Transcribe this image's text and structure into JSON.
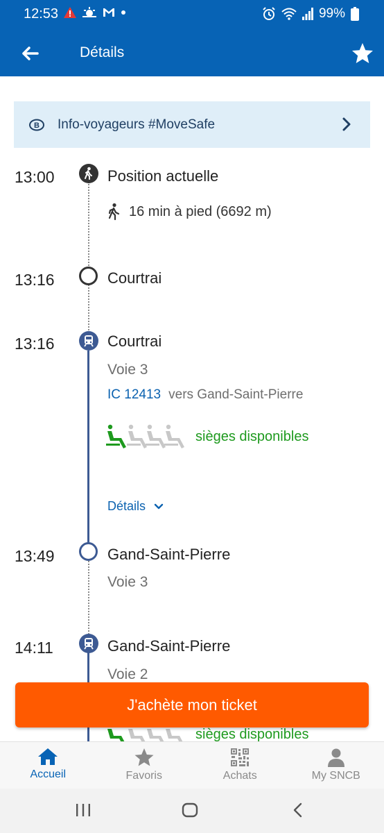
{
  "status_bar": {
    "time": "12:53",
    "battery": "99%",
    "icons": [
      "warning-icon",
      "weather-icon",
      "gmail-icon",
      "dot-icon",
      "alarm-icon",
      "wifi-icon",
      "signal-icon",
      "battery-icon"
    ]
  },
  "app_bar": {
    "title": "Détails"
  },
  "banner": {
    "text": "Info-voyageurs #MoveSafe"
  },
  "timeline": {
    "start": {
      "time": "13:00",
      "label": "Position actuelle",
      "walk": "16 min à pied (6692 m)"
    },
    "walk_end": {
      "time": "13:16",
      "station": "Courtrai"
    },
    "dep1": {
      "time": "13:16",
      "station": "Courtrai",
      "platform": "Voie 3",
      "train_id": "IC 12413",
      "destination": "vers Gand-Saint-Pierre",
      "seats": "sièges disponibles",
      "occupancy_level": 1,
      "details": "Détails"
    },
    "arr1": {
      "time": "13:49",
      "station": "Gand-Saint-Pierre",
      "platform": "Voie 3"
    },
    "dep2": {
      "time": "14:11",
      "station": "Gand-Saint-Pierre",
      "platform": "Voie 2",
      "seats": "sièges disponibles"
    }
  },
  "buy_button": {
    "label": "J'achète mon ticket"
  },
  "bottom_nav": {
    "items": [
      {
        "label": "Accueil",
        "icon": "home-icon",
        "active": true
      },
      {
        "label": "Favoris",
        "icon": "star-icon",
        "active": false
      },
      {
        "label": "Achats",
        "icon": "qr-code-icon",
        "active": false
      },
      {
        "label": "My SNCB",
        "icon": "person-icon",
        "active": false
      }
    ]
  },
  "colors": {
    "brand_blue": "#0763b5",
    "accent_orange": "#ff5a00",
    "seat_green": "#1e9a1e",
    "line_blue": "#3d5a93"
  }
}
